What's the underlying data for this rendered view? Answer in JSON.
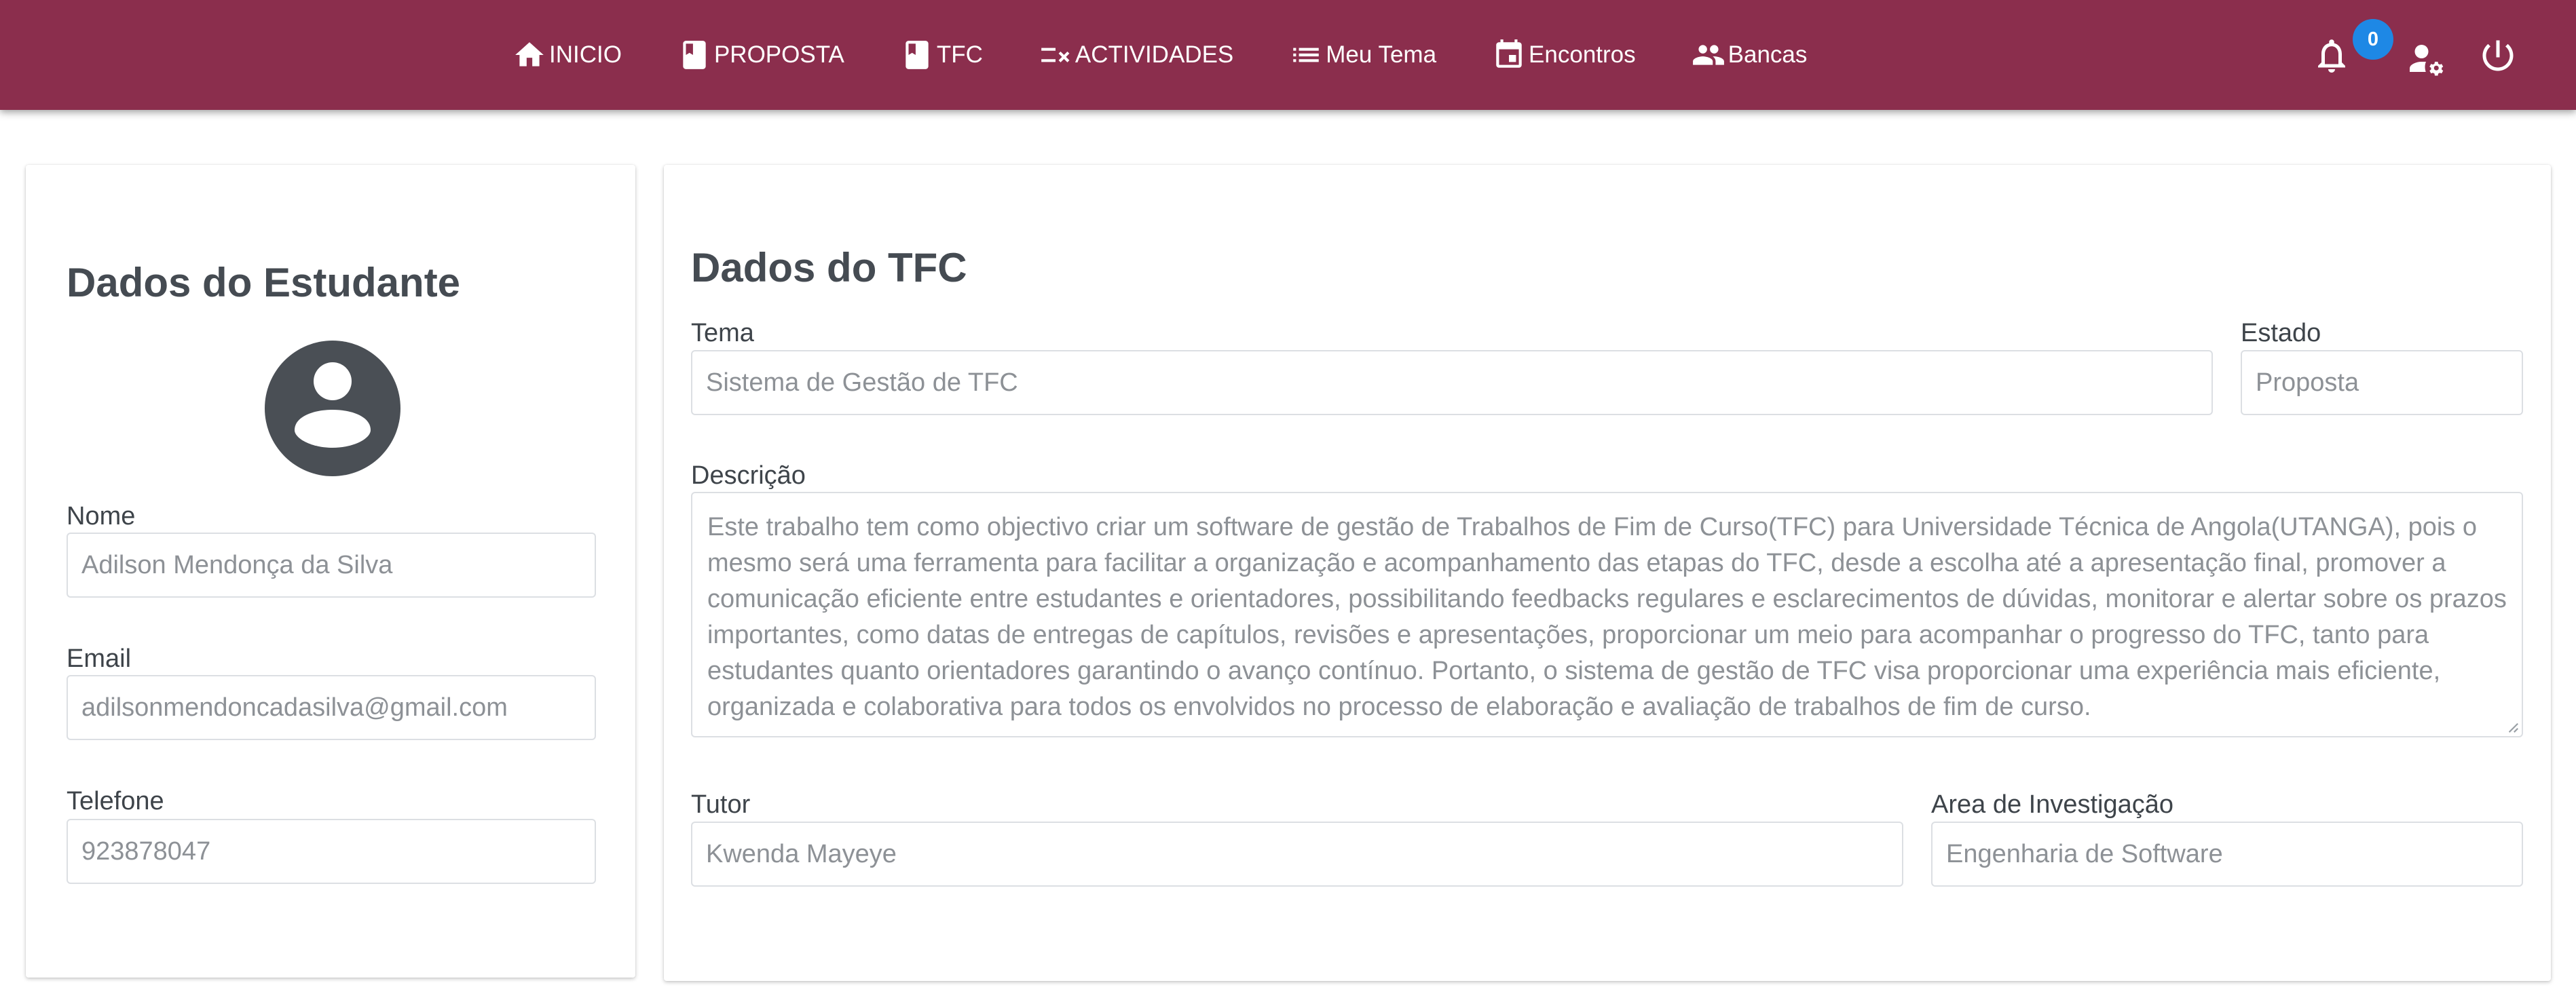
{
  "nav": {
    "items": [
      {
        "label": "INICIO",
        "icon": "home-icon"
      },
      {
        "label": "PROPOSTA",
        "icon": "book-icon"
      },
      {
        "label": "TFC",
        "icon": "book-icon"
      },
      {
        "label": "ACTIVIDADES",
        "icon": "checklist-icon"
      },
      {
        "label": "Meu Tema",
        "icon": "list-icon"
      },
      {
        "label": "Encontros",
        "icon": "calendar-icon"
      },
      {
        "label": "Bancas",
        "icon": "people-icon"
      }
    ],
    "notifications_count": "0",
    "bar_color": "#8b2e4d",
    "badge_color": "#1e88e5"
  },
  "student": {
    "title": "Dados do Estudante",
    "name_label": "Nome",
    "name_value": "Adilson Mendonça da Silva",
    "email_label": "Email",
    "email_value": "adilsonmendoncadasilva@gmail.com",
    "phone_label": "Telefone",
    "phone_value": "923878047"
  },
  "tfc": {
    "title": "Dados do TFC",
    "theme_label": "Tema",
    "theme_value": "Sistema de Gestão de TFC",
    "state_label": "Estado",
    "state_value": "Proposta",
    "description_label": "Descrição",
    "description_value": "Este trabalho tem como objectivo criar um software de gestão de Trabalhos de Fim de Curso(TFC) para Universidade Técnica de Angola(UTANGA), pois o mesmo será uma ferramenta para facilitar a organização e acompanhamento das etapas do TFC, desde a escolha até a apresentação final, promover a comunicação eficiente entre estudantes e orientadores, possibilitando feedbacks regulares e esclarecimentos de dúvidas, monitorar e alertar sobre os prazos importantes, como datas de entregas de capítulos, revisões e apresentações, proporcionar um meio para acompanhar o progresso do TFC, tanto para estudantes quanto orientadores garantindo o avanço contínuo. Portanto, o sistema de gestão de TFC visa proporcionar uma experiência mais eficiente, organizada e colaborativa para todos os envolvidos no processo de elaboração e avaliação de trabalhos de fim de curso.",
    "tutor_label": "Tutor",
    "tutor_value": "Kwenda Mayeye",
    "area_label": "Area de Investigação",
    "area_value": "Engenharia de Software"
  }
}
